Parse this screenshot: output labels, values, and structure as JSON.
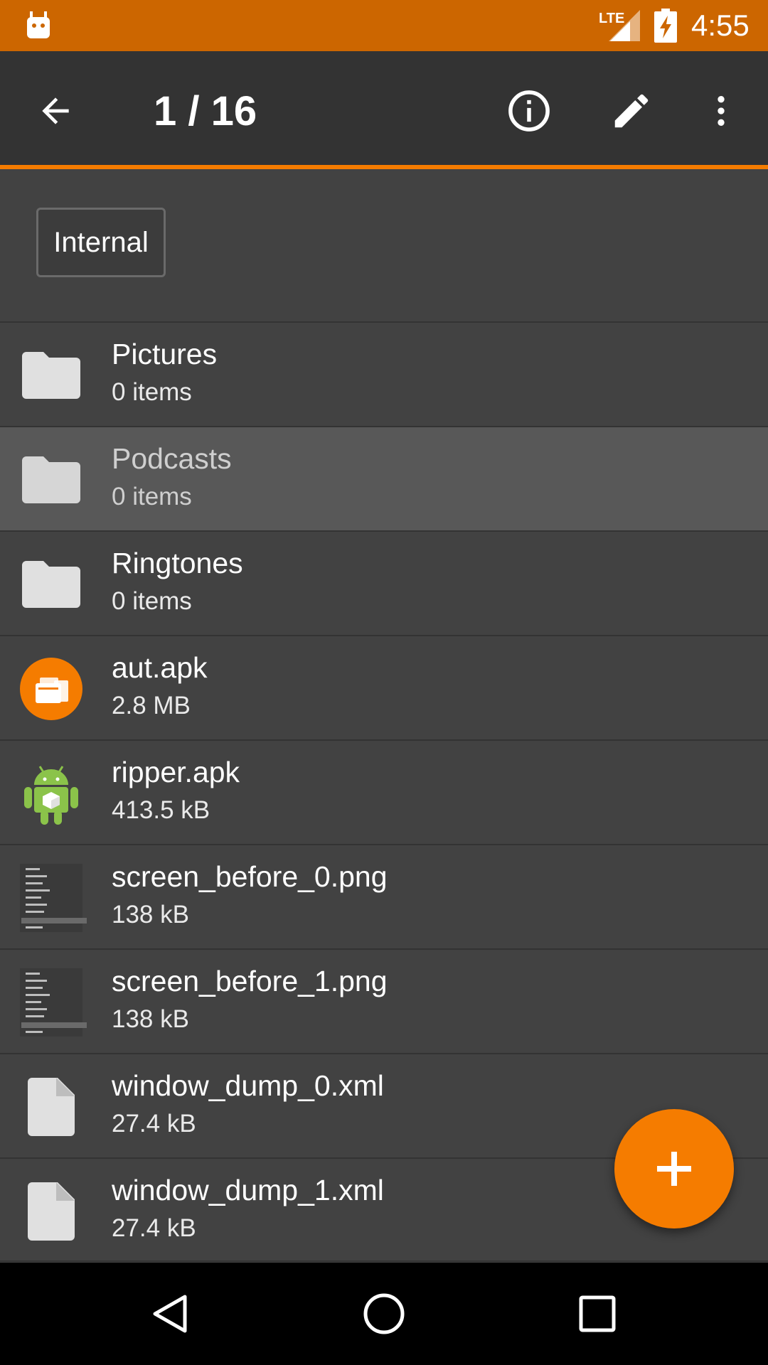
{
  "status_bar": {
    "time": "4:55",
    "network": "LTE",
    "color": "#CC6600",
    "icons": [
      "android-notification-icon",
      "lte-signal-icon",
      "battery-charging-icon"
    ]
  },
  "toolbar": {
    "title": "1 / 16",
    "accent": "#F57C00",
    "icons": [
      "back-arrow-icon",
      "info-icon",
      "edit-pencil-icon",
      "more-vert-icon"
    ]
  },
  "storage": {
    "chip_label": "Internal"
  },
  "files": [
    {
      "name": "Pictures",
      "meta": "0 items",
      "icon": "folder-icon",
      "selected": false
    },
    {
      "name": "Podcasts",
      "meta": "0 items",
      "icon": "folder-icon",
      "selected": true
    },
    {
      "name": "Ringtones",
      "meta": "0 items",
      "icon": "folder-icon",
      "selected": false
    },
    {
      "name": "aut.apk",
      "meta": "2.8 MB",
      "icon": "app-apk-icon",
      "selected": false
    },
    {
      "name": "ripper.apk",
      "meta": "413.5 kB",
      "icon": "android-apk-icon",
      "selected": false
    },
    {
      "name": "screen_before_0.png",
      "meta": "138 kB",
      "icon": "image-thumbnail",
      "selected": false
    },
    {
      "name": "screen_before_1.png",
      "meta": "138 kB",
      "icon": "image-thumbnail",
      "selected": false
    },
    {
      "name": "window_dump_0.xml",
      "meta": "27.4 kB",
      "icon": "file-icon",
      "selected": false
    },
    {
      "name": "window_dump_1.xml",
      "meta": "27.4 kB",
      "icon": "file-icon",
      "selected": false
    }
  ],
  "fab": {
    "icon": "plus-icon",
    "color": "#F57C00"
  },
  "nav_bar": {
    "icons": [
      "nav-back-icon",
      "nav-home-icon",
      "nav-recents-icon"
    ]
  }
}
